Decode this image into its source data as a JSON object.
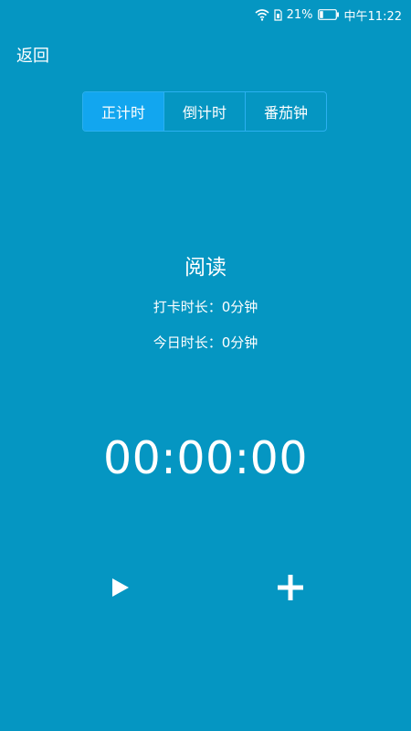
{
  "status_bar": {
    "battery_percent": "21%",
    "battery_level": 0.21,
    "time": "中午11:22"
  },
  "header": {
    "back_label": "返回"
  },
  "tabs": [
    {
      "label": "正计时",
      "active": true
    },
    {
      "label": "倒计时",
      "active": false
    },
    {
      "label": "番茄钟",
      "active": false
    }
  ],
  "activity": {
    "name": "阅读",
    "checkin_duration": "打卡时长：0分钟",
    "today_duration": "今日时长：0分钟"
  },
  "timer": {
    "display": "00:00:00"
  },
  "controls": {
    "play_icon": "play-icon",
    "add_icon": "plus-icon"
  },
  "colors": {
    "background": "#0596c2",
    "active_tab": "#12a6ef",
    "tab_border": "#2bb0f0",
    "text": "#ffffff"
  }
}
